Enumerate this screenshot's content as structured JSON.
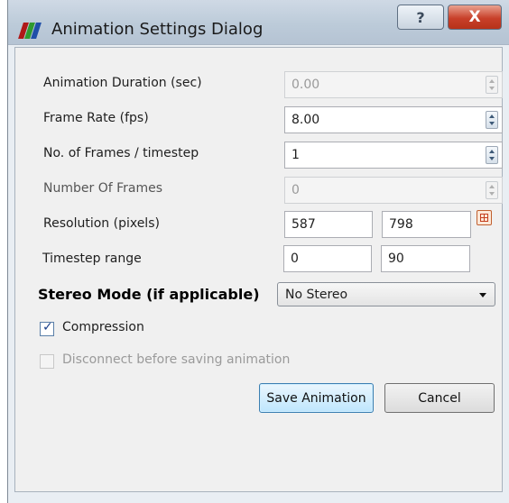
{
  "window": {
    "title": "Animation Settings Dialog",
    "help_glyph": "?",
    "close_glyph": "X",
    "app_icon_colors": [
      "#b01818",
      "#2f9a2f",
      "#1f4fa8"
    ]
  },
  "fields": {
    "duration": {
      "label": "Animation Duration (sec)",
      "value": "0.00"
    },
    "frame_rate": {
      "label": "Frame Rate (fps)",
      "value": "8.00"
    },
    "frames_per_timestep": {
      "label": "No. of Frames / timestep",
      "value": "1"
    },
    "number_of_frames": {
      "label": "Number Of Frames",
      "value": "0"
    },
    "resolution": {
      "label": "Resolution (pixels)",
      "width": "587",
      "height": "798"
    },
    "timestep_range": {
      "label": "Timestep range",
      "start": "0",
      "end": "90"
    }
  },
  "stereo": {
    "label": "Stereo Mode (if applicable)",
    "selected": "No Stereo"
  },
  "checkboxes": {
    "compression": {
      "label": "Compression",
      "checked": true
    },
    "disconnect": {
      "label": "Disconnect before saving animation",
      "checked": false,
      "enabled": false
    }
  },
  "buttons": {
    "save": "Save Animation",
    "cancel": "Cancel"
  }
}
